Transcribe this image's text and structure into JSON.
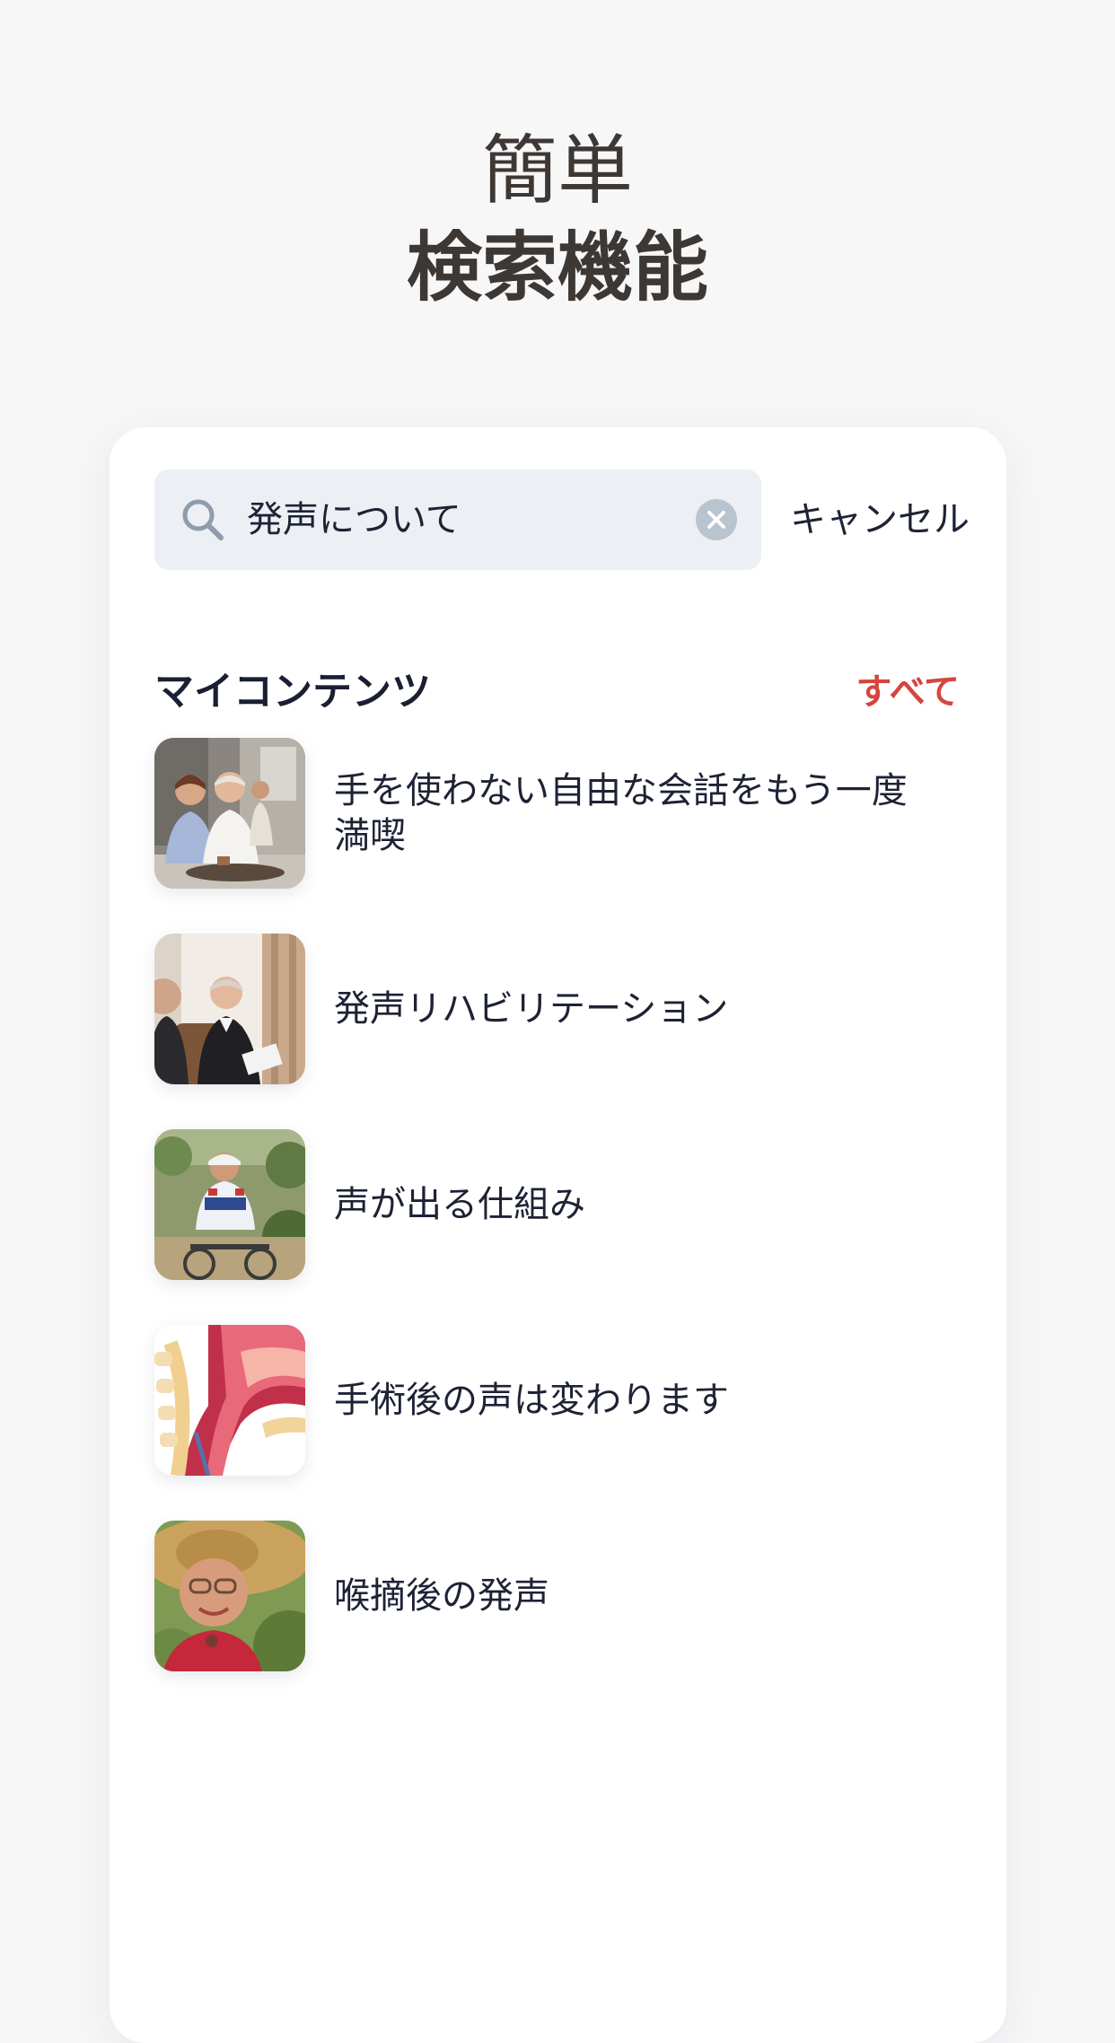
{
  "hero": {
    "line1": "簡単",
    "line2": "検索機能"
  },
  "search": {
    "value": "発声について",
    "cancel_label": "キャンセル"
  },
  "section": {
    "title": "マイコンテンツ",
    "see_all_label": "すべて"
  },
  "items": [
    {
      "label": "手を使わない自由な会話をもう一度満喫"
    },
    {
      "label": "発声リハビリテーション"
    },
    {
      "label": "声が出る仕組み"
    },
    {
      "label": "手術後の声は変わります"
    },
    {
      "label": "喉摘後の発声"
    }
  ],
  "colors": {
    "background": "#f7f7f8",
    "card": "#ffffff",
    "search_field": "#eceff3",
    "accent": "#d6453f",
    "text": "#1e2235",
    "hero_text": "#3e3835"
  }
}
